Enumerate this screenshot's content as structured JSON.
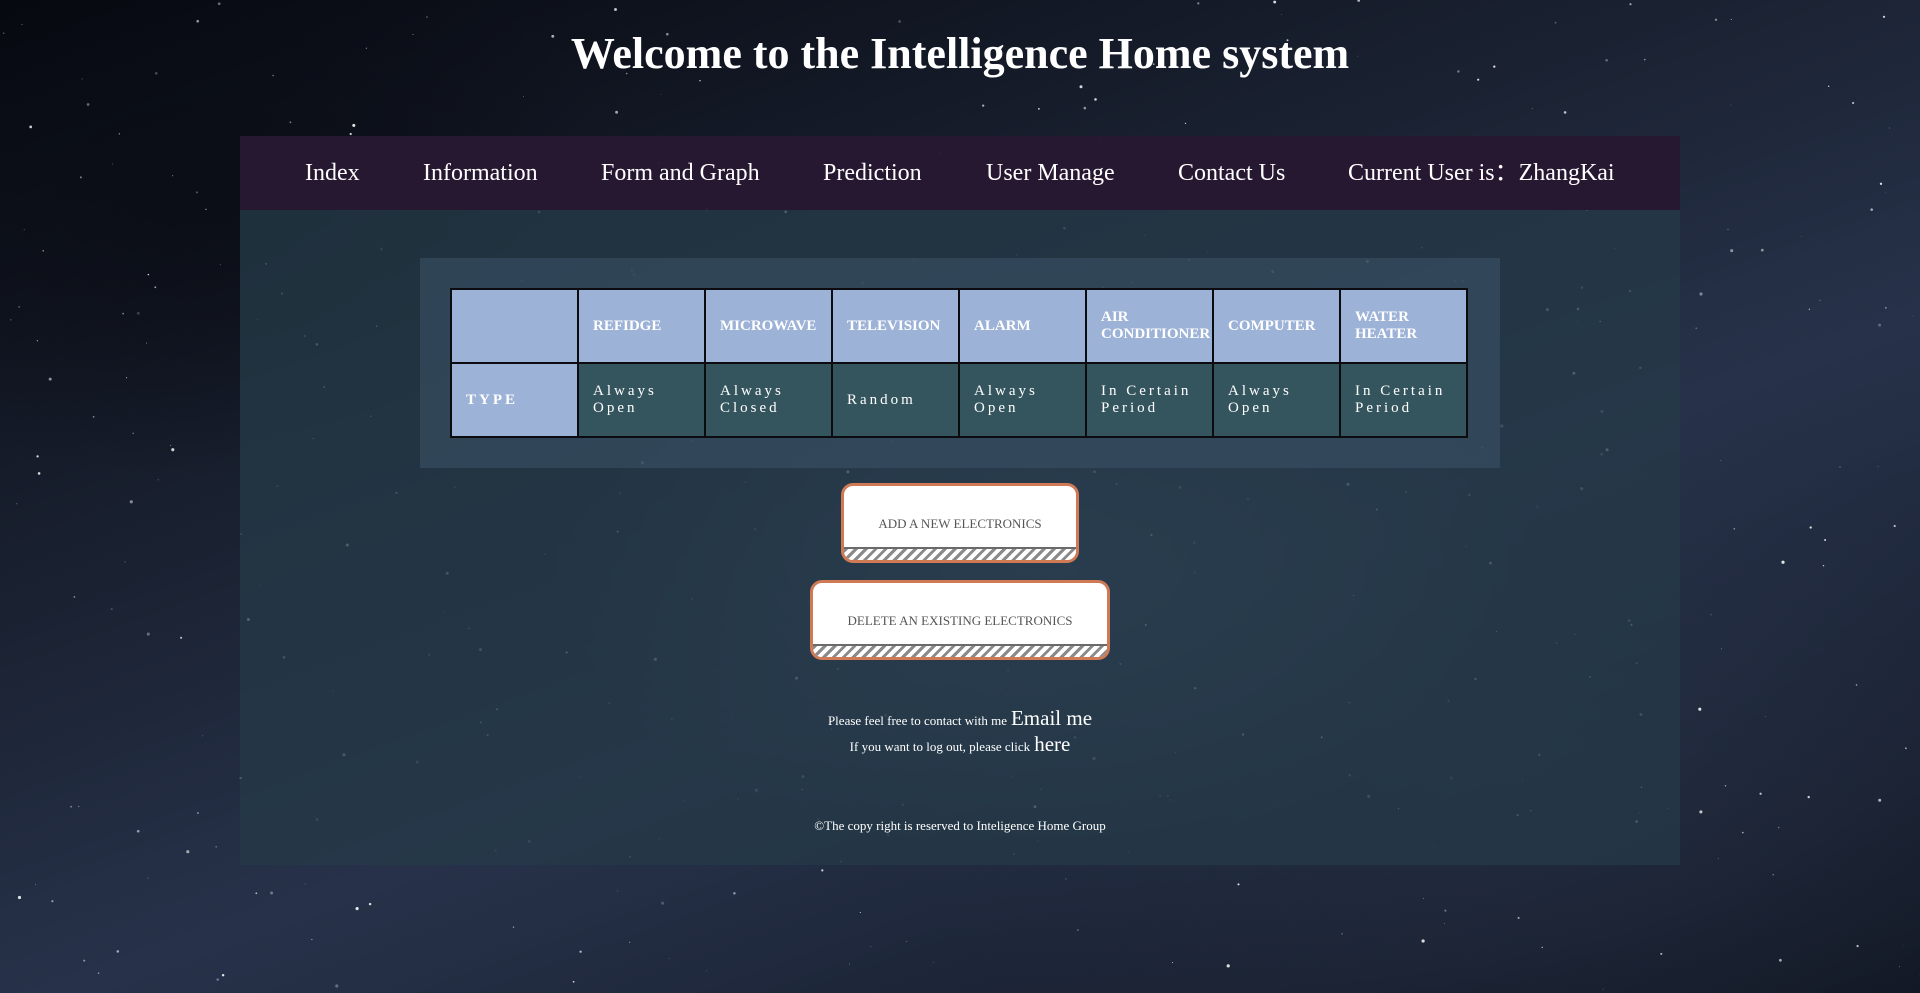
{
  "page": {
    "title": "Welcome to the Intelligence Home system"
  },
  "nav": {
    "items": [
      {
        "label": "Index"
      },
      {
        "label": "Information"
      },
      {
        "label": "Form and Graph"
      },
      {
        "label": "Prediction"
      },
      {
        "label": "User Manage"
      },
      {
        "label": "Contact Us"
      }
    ],
    "current_user": "Current User is：ZhangKai"
  },
  "devices_table": {
    "corner": "",
    "headers": [
      "REFIDGE",
      "MICROWAVE",
      "TELEVISION",
      "ALARM",
      "AIR CONDITIONER",
      "COMPUTER",
      "WATER HEATER"
    ],
    "row_label": "TYPE",
    "values": [
      "Always Open",
      "Always Closed",
      "Random",
      "Always Open",
      "In Certain Period",
      "Always Open",
      "In Certain Period"
    ]
  },
  "actions": {
    "add_label": "ADD A NEW ELECTRONICS",
    "delete_label": "DELETE AN EXISTING ELECTRONICS"
  },
  "contact": {
    "line1_text": "Please feel free to contact with me",
    "email_link": "Email me",
    "line2_text": "If you want to log out, please click",
    "logout_link": "here"
  },
  "footer": {
    "copyright": "©The copy right is reserved to Inteligence Home Group"
  },
  "colors": {
    "nav_bg": "#281430",
    "table_header_bg": "#9db2d7",
    "table_cell_bg": "#35555e",
    "button_border": "#cf7a55"
  }
}
